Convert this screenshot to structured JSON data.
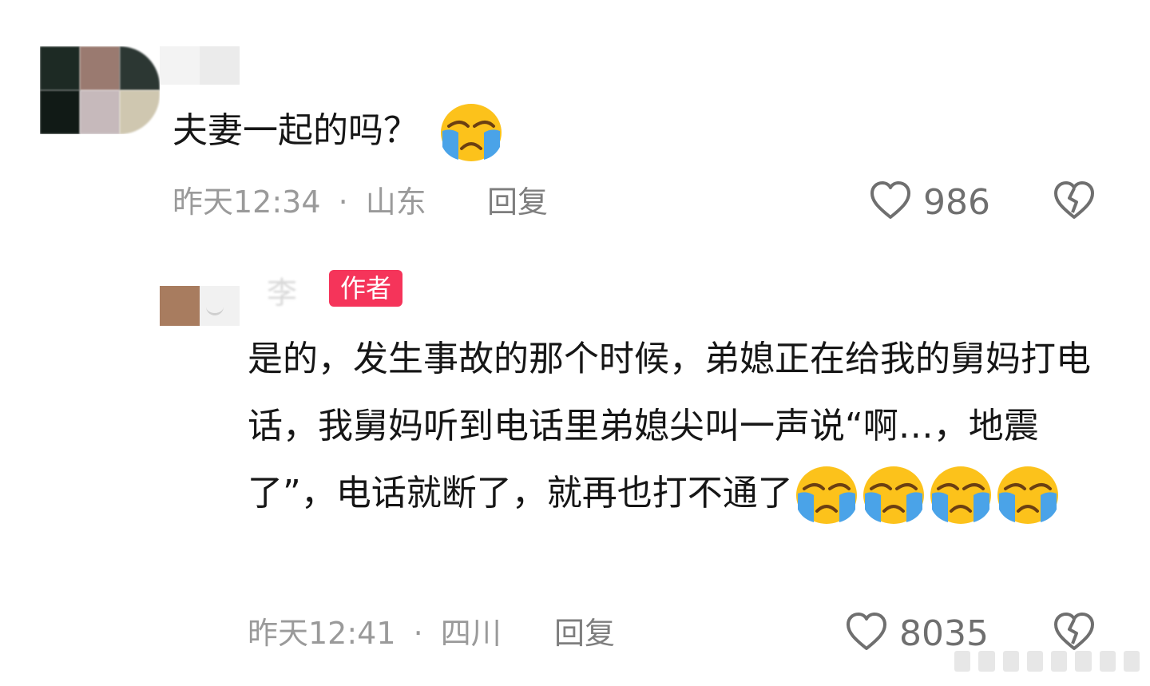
{
  "comments": [
    {
      "text": "夫妻一起的吗？",
      "time": "昨天12:34",
      "separator": "·",
      "location": "山东",
      "reply_label": "回复",
      "likes": "986",
      "emoji": [
        "loudly-crying-face"
      ]
    },
    {
      "author_badge": "作者",
      "text": "是的，发生事故的那个时候，弟媳正在给我的舅妈打电话，我舅妈听到电话里弟媳尖叫一声说“啊…，地震了”，电话就断了，就再也打不通了",
      "time": "昨天12:41",
      "separator": "·",
      "location": "四川",
      "reply_label": "回复",
      "likes": "8035",
      "emoji": [
        "loudly-crying-face",
        "loudly-crying-face",
        "loudly-crying-face",
        "loudly-crying-face"
      ]
    }
  ],
  "colors": {
    "badge": "#f5345a",
    "text": "#161616",
    "meta": "#9a9a9a",
    "emoji_face": "#fcc21b",
    "emoji_tears": "#4aa3e8"
  },
  "icons": [
    "heart-outline-icon",
    "broken-heart-icon"
  ]
}
